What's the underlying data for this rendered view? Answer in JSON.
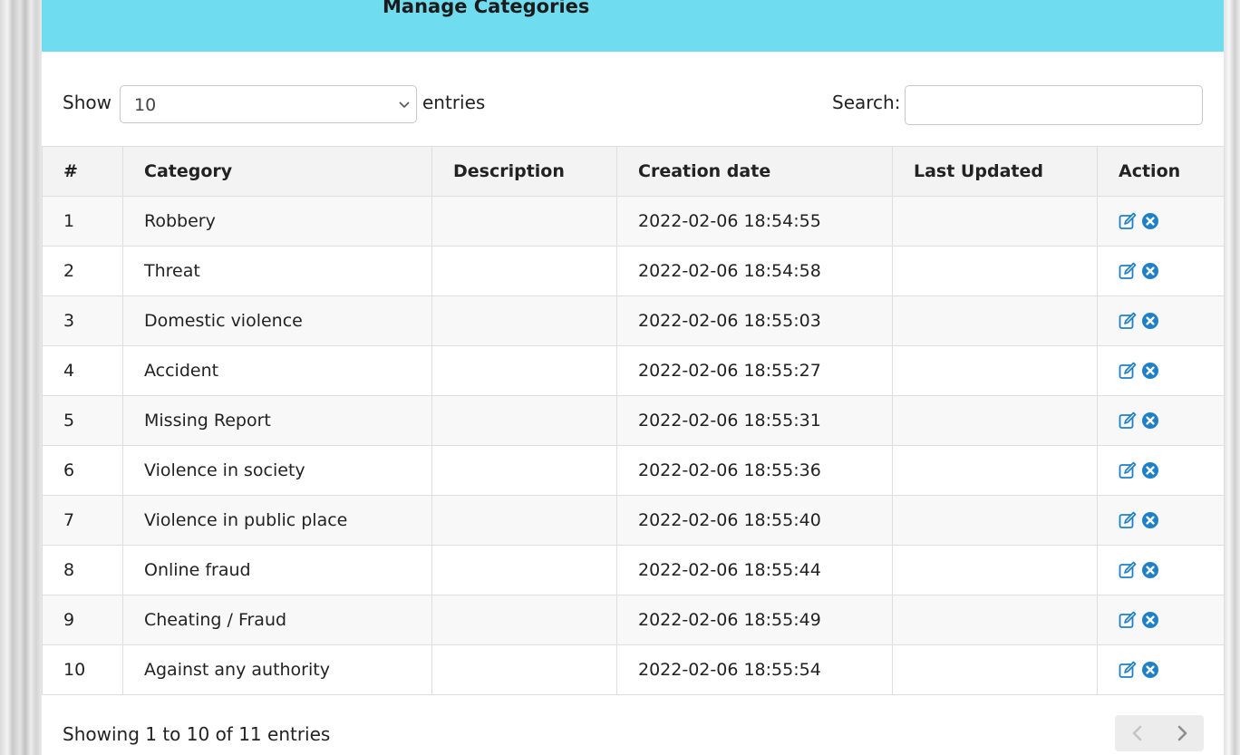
{
  "header": {
    "title": "Manage Categories"
  },
  "length_control": {
    "show_label": "Show",
    "selected": "10",
    "entries_label": "entries"
  },
  "search": {
    "label": "Search:",
    "value": "",
    "placeholder": ""
  },
  "table": {
    "columns": [
      "#",
      "Category",
      "Description",
      "Creation date",
      "Last Updated",
      "Action"
    ],
    "rows": [
      {
        "num": "1",
        "category": "Robbery",
        "description": "",
        "created": "2022-02-06 18:54:55",
        "updated": ""
      },
      {
        "num": "2",
        "category": "Threat",
        "description": "",
        "created": "2022-02-06 18:54:58",
        "updated": ""
      },
      {
        "num": "3",
        "category": "Domestic violence",
        "description": "",
        "created": "2022-02-06 18:55:03",
        "updated": ""
      },
      {
        "num": "4",
        "category": "Accident",
        "description": "",
        "created": "2022-02-06 18:55:27",
        "updated": ""
      },
      {
        "num": "5",
        "category": "Missing Report",
        "description": "",
        "created": "2022-02-06 18:55:31",
        "updated": ""
      },
      {
        "num": "6",
        "category": "Violence in society",
        "description": "",
        "created": "2022-02-06 18:55:36",
        "updated": ""
      },
      {
        "num": "7",
        "category": "Violence in public place",
        "description": "",
        "created": "2022-02-06 18:55:40",
        "updated": ""
      },
      {
        "num": "8",
        "category": "Online fraud",
        "description": "",
        "created": "2022-02-06 18:55:44",
        "updated": ""
      },
      {
        "num": "9",
        "category": "Cheating / Fraud",
        "description": "",
        "created": "2022-02-06 18:55:49",
        "updated": ""
      },
      {
        "num": "10",
        "category": "Against any authority",
        "description": "",
        "created": "2022-02-06 18:55:54",
        "updated": ""
      }
    ],
    "action_icons": [
      "edit-icon",
      "delete-icon"
    ]
  },
  "footer": {
    "info": "Showing 1 to 10 of 11 entries"
  },
  "pagination": {
    "prev_icon": "chevron-left-icon",
    "next_icon": "chevron-right-icon"
  },
  "colors": {
    "header_bg": "#70dcf0",
    "icon_blue": "#1f80c8",
    "table_header_bg": "#f3f3f3",
    "stripe_bg": "#f8f8f8"
  }
}
